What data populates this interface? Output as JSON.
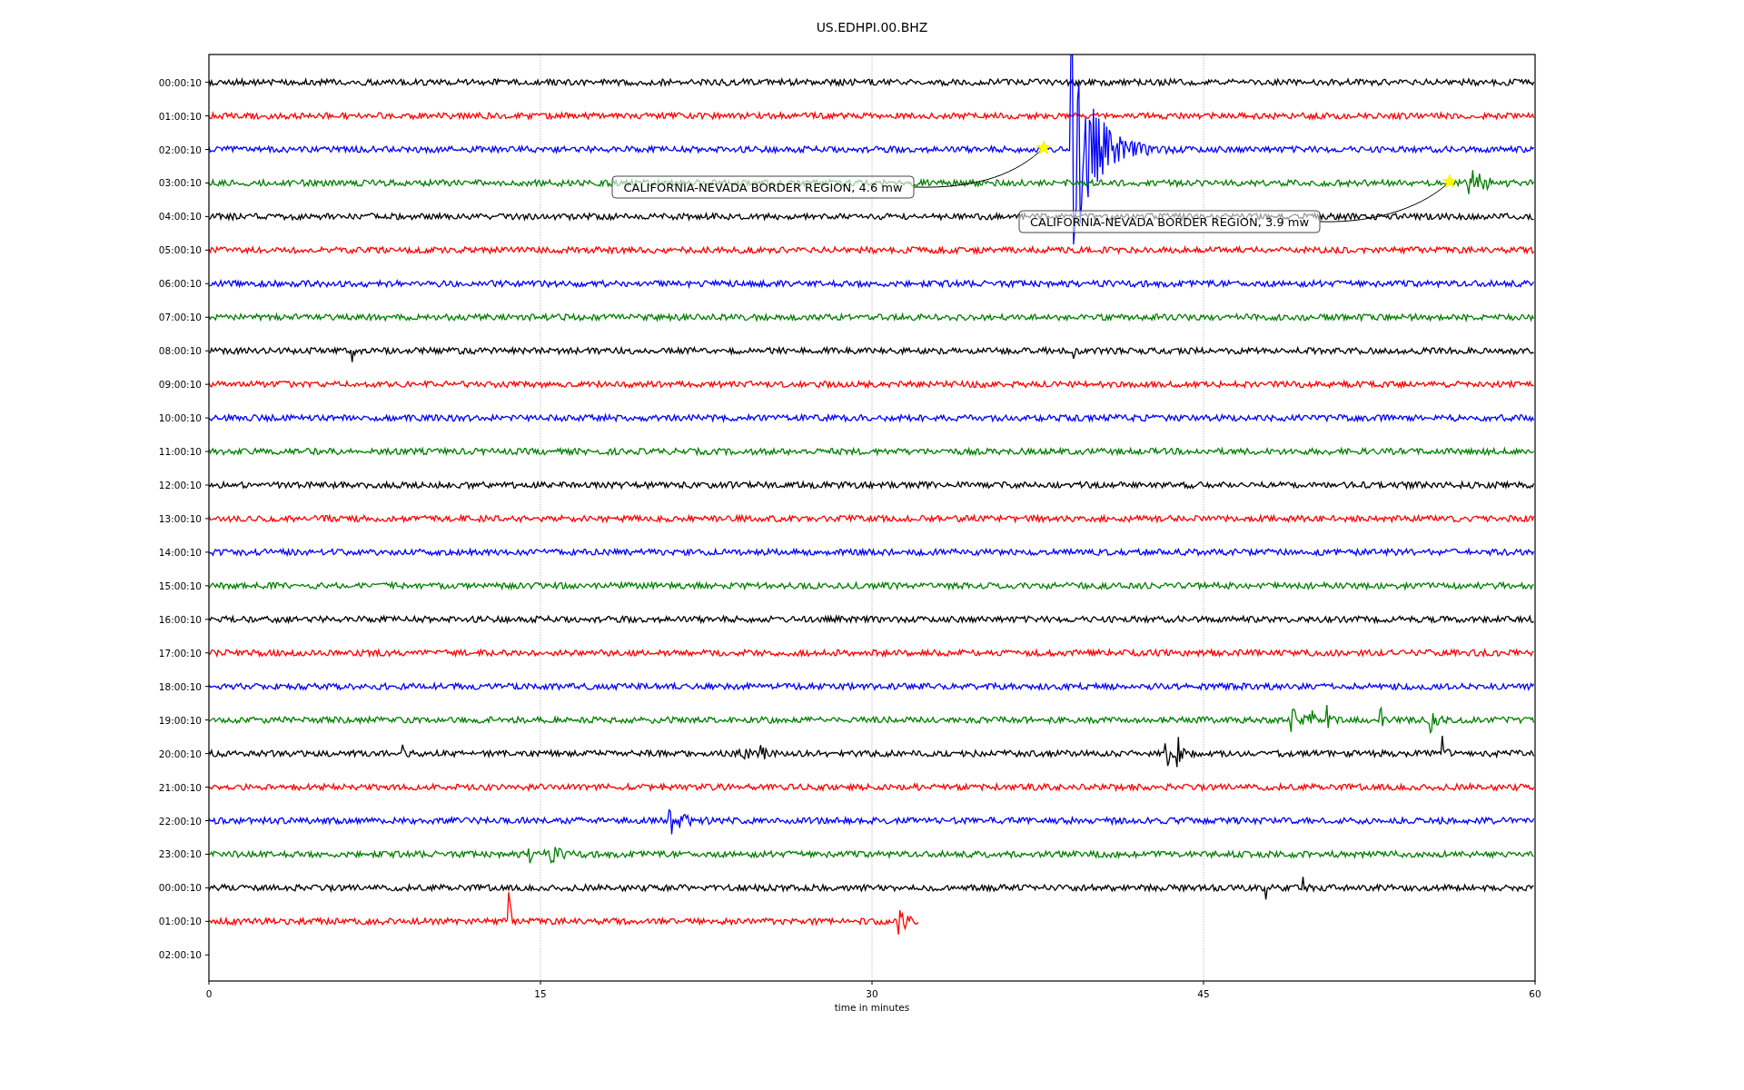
{
  "title": "US.EDHPI.00.BHZ",
  "x_axis": {
    "label": "time in minutes",
    "ticks": [
      "0",
      "15",
      "30",
      "45",
      "60"
    ]
  },
  "rows": [
    {
      "label": "00:00:10",
      "color": "#000000",
      "level": 1
    },
    {
      "label": "01:00:10",
      "color": "#ff0000",
      "level": 1
    },
    {
      "label": "02:00:10",
      "color": "#0000ff",
      "level": 1
    },
    {
      "label": "03:00:10",
      "color": "#008000",
      "level": 1
    },
    {
      "label": "04:00:10",
      "color": "#000000",
      "level": 1
    },
    {
      "label": "05:00:10",
      "color": "#ff0000",
      "level": 1
    },
    {
      "label": "06:00:10",
      "color": "#0000ff",
      "level": 1
    },
    {
      "label": "07:00:10",
      "color": "#008000",
      "level": 1
    },
    {
      "label": "08:00:10",
      "color": "#000000",
      "level": 1
    },
    {
      "label": "09:00:10",
      "color": "#ff0000",
      "level": 1
    },
    {
      "label": "10:00:10",
      "color": "#0000ff",
      "level": 1
    },
    {
      "label": "11:00:10",
      "color": "#008000",
      "level": 1
    },
    {
      "label": "12:00:10",
      "color": "#000000",
      "level": 1
    },
    {
      "label": "13:00:10",
      "color": "#ff0000",
      "level": 1
    },
    {
      "label": "14:00:10",
      "color": "#0000ff",
      "level": 1
    },
    {
      "label": "15:00:10",
      "color": "#008000",
      "level": 1
    },
    {
      "label": "16:00:10",
      "color": "#000000",
      "level": 1
    },
    {
      "label": "17:00:10",
      "color": "#ff0000",
      "level": 1
    },
    {
      "label": "18:00:10",
      "color": "#0000ff",
      "level": 1
    },
    {
      "label": "19:00:10",
      "color": "#008000",
      "level": 1
    },
    {
      "label": "20:00:10",
      "color": "#000000",
      "level": 1
    },
    {
      "label": "21:00:10",
      "color": "#ff0000",
      "level": 1
    },
    {
      "label": "22:00:10",
      "color": "#0000ff",
      "level": 1
    },
    {
      "label": "23:00:10",
      "color": "#008000",
      "level": 1
    },
    {
      "label": "00:00:10",
      "color": "#000000",
      "level": 1
    },
    {
      "label": "01:00:10",
      "color": "#ff0000",
      "level": 0.535
    },
    {
      "label": "02:00:10"
    }
  ],
  "events": [
    {
      "label": "CALIFORNIA-NEVADA BORDER REGION, 4.6 mw"
    },
    {
      "label": "CALIFORNIA-NEVADA BORDER REGION, 3.9 mw"
    }
  ]
}
